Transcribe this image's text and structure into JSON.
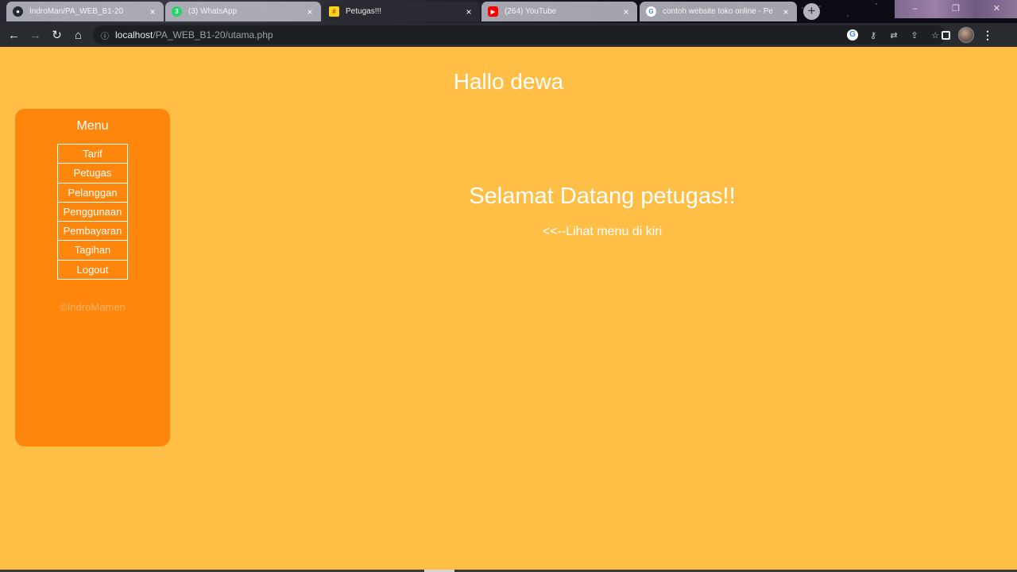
{
  "browser": {
    "tabs": [
      {
        "title": "IndroMan/PA_WEB_B1-20",
        "icon": "github-icon",
        "close": "×"
      },
      {
        "title": "(3) WhatsApp",
        "icon": "whatsapp-icon",
        "close": "×"
      },
      {
        "title": "Petugas!!!",
        "icon": "hash-favicon-icon",
        "close": "×"
      },
      {
        "title": "(264) YouTube",
        "icon": "youtube-icon",
        "close": "×"
      },
      {
        "title": "contoh website toko online - Pe",
        "icon": "google-icon",
        "close": "×"
      }
    ],
    "active_tab": 2,
    "new_tab": "+",
    "url_host": "localhost",
    "url_path": "/PA_WEB_B1-20/utama.php",
    "colors": {
      "chrome": "#2a2b30",
      "omnibox": "#1e1f23"
    }
  },
  "page": {
    "greeting": "Hallo dewa",
    "menu": {
      "title": "Menu",
      "items": [
        "Tarif",
        "Petugas",
        "Pelanggan",
        "Penggunaan",
        "Pembayaran",
        "Tagihan",
        "Logout"
      ]
    },
    "copyright": "©IndroMamen",
    "welcome": "Selamat Datang petugas!!",
    "hint": "<<--Lihat menu di kiri",
    "colors": {
      "background": "#ffbf47",
      "sidebar": "#ff860d",
      "text": "#ffffff"
    }
  }
}
